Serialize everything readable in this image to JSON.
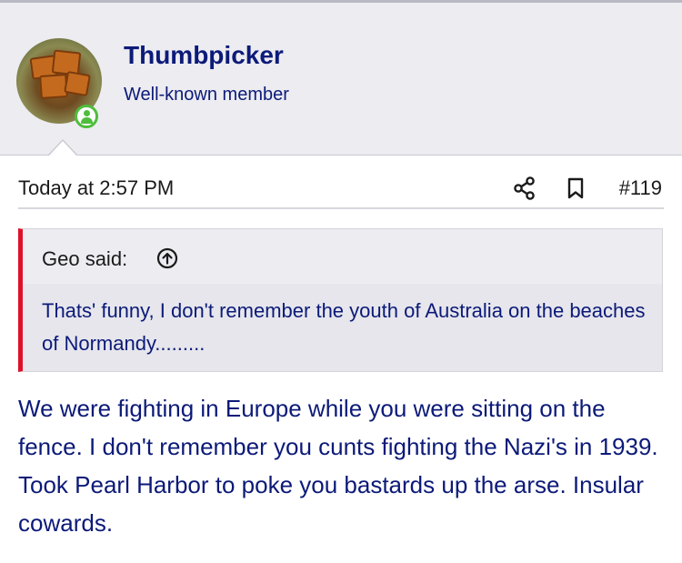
{
  "post": {
    "author": {
      "name": "Thumbpicker",
      "title": "Well-known member",
      "avatar_icon": "toast-avatar",
      "online_status": "online"
    },
    "timestamp": "Today at 2:57 PM",
    "post_number": "#119",
    "actions": {
      "share_icon": "share-icon",
      "bookmark_icon": "bookmark-icon"
    },
    "quote": {
      "author_line": "Geo said:",
      "expand_icon": "circle-arrow-up-icon",
      "text": "Thats' funny, I don't remember the youth of Australia on the beaches of Normandy.........",
      "accent_color": "#e0102a"
    },
    "body": "We were fighting in Europe while you were sitting on the fence. I don't remember you cunts fighting the Nazi's in 1939. Took Pearl Harbor to poke you bastards up the arse. Insular cowards."
  },
  "colors": {
    "link_blue": "#0c1a78",
    "header_bg": "#ececf1",
    "online_green": "#4fbd3c"
  }
}
